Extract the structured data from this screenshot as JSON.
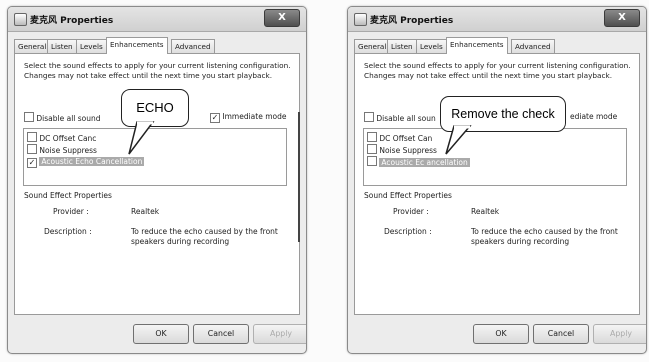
{
  "windows": [
    {
      "title": "麦克风 Properties",
      "close_label": "X",
      "tabs": [
        "General",
        "Listen",
        "Levels",
        "Enhancements",
        "Advanced"
      ],
      "active_tab": "Enhancements",
      "instructions": "Select the sound effects to apply for your current listening configuration. Changes may not take effect until the next time you start playback.",
      "disable_all_label": "Disable all sound",
      "disable_all_checked": false,
      "immediate_mode_label": "Immediate mode",
      "immediate_mode_checked": true,
      "effects": [
        {
          "label": "DC Offset Canc",
          "checked": false
        },
        {
          "label": "Noise Suppress",
          "checked": false
        },
        {
          "label": "Acoustic Echo Cancellation",
          "checked": true,
          "selected": true
        }
      ],
      "properties_heading": "Sound Effect Properties",
      "provider_label": "Provider :",
      "provider_value": "Realtek",
      "description_label": "Description :",
      "description_value": "To reduce the echo caused by the front speakers during recording",
      "ok_label": "OK",
      "cancel_label": "Cancel",
      "apply_label": "Apply",
      "callout": "ECHO"
    },
    {
      "title": "麦克风 Properties",
      "close_label": "X",
      "tabs": [
        "General",
        "Listen",
        "Levels",
        "Enhancements",
        "Advanced"
      ],
      "active_tab": "Enhancements",
      "instructions": "Select the sound effects to apply for your current listening configuration. Changes may not take effect until the next time you start playback.",
      "disable_all_label": "Disable all soun",
      "disable_all_checked": false,
      "immediate_mode_label": "ediate mode",
      "immediate_mode_checked": false,
      "effects": [
        {
          "label": "DC Offset Can",
          "checked": false
        },
        {
          "label": "Noise Suppress",
          "checked": false
        },
        {
          "label": "Acoustic Ec  ancellation",
          "checked": false,
          "selected": true
        }
      ],
      "properties_heading": "Sound Effect Properties",
      "provider_label": "Provider :",
      "provider_value": "Realtek",
      "description_label": "Description :",
      "description_value": "To reduce the echo caused by the front speakers during recording",
      "ok_label": "OK",
      "cancel_label": "Cancel",
      "apply_label": "Apply",
      "callout": "Remove the check"
    }
  ]
}
